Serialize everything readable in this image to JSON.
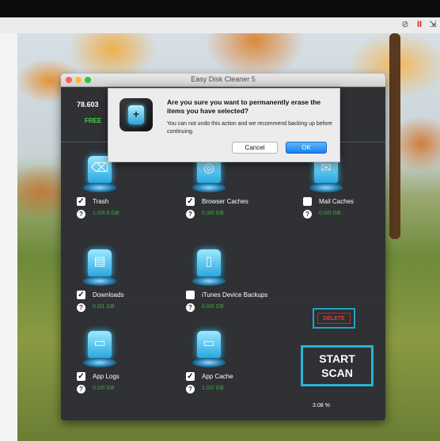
{
  "window": {
    "title": "Easy Disk Cleaner 5",
    "free_space": "78.603",
    "free_label": "FREE"
  },
  "items": [
    {
      "label": "Trash",
      "checked": true,
      "size": "1.0/4.0 GB",
      "icon": "trash-hologram-icon"
    },
    {
      "label": "Browser Caches",
      "checked": true,
      "size": "0.3/0 GB",
      "icon": "globe-hologram-icon"
    },
    {
      "label": "Mail Caches",
      "checked": false,
      "size": "0.0/0 GB",
      "icon": "mail-hologram-icon"
    },
    {
      "label": "Downloads",
      "checked": true,
      "size": "0.0/1 GB",
      "icon": "document-hologram-icon"
    },
    {
      "label": "iTunes Device Backups",
      "checked": false,
      "size": "0.0/0 GB",
      "icon": "device-hologram-icon"
    },
    {
      "label": "App Logs",
      "checked": true,
      "size": "0.0/0 GB",
      "icon": "folder-hologram-icon"
    },
    {
      "label": "App Cache",
      "checked": true,
      "size": "1.0/2 GB",
      "icon": "folder-hologram-icon"
    }
  ],
  "buttons": {
    "delete": "DELETE",
    "scan": [
      "START",
      "SCAN"
    ]
  },
  "progress_text": "3.08 %",
  "dialog": {
    "title": "Are you sure you want to permanently erase the items you have selected?",
    "message": "You can not undo this action and we recommend backing up before continuing.",
    "cancel": "Cancel",
    "ok": "OK"
  },
  "checkmark": "✓",
  "help": "?",
  "colors": {
    "accent": "#28b3d8",
    "free_green": "#4cd04c",
    "delete_red": "#e53935",
    "ok_blue": "#1a7ff0"
  }
}
